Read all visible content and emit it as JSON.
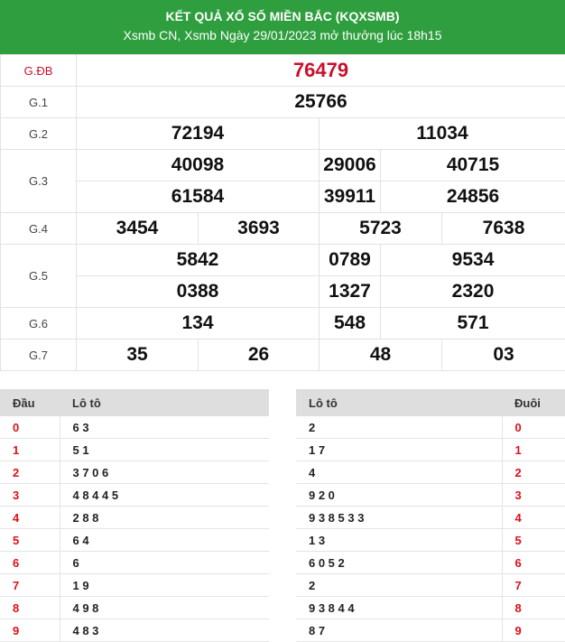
{
  "header": {
    "title": "KẾT QUẢ XỔ SỐ MIỀN BẮC (KQXSMB)",
    "subtitle": "Xsmb CN, Xsmb Ngày 29/01/2023 mở thưởng lúc 18h15"
  },
  "prizes": {
    "db": {
      "label": "G.ĐB",
      "nums": [
        "76479"
      ]
    },
    "g1": {
      "label": "G.1",
      "nums": [
        "25766"
      ]
    },
    "g2": {
      "label": "G.2",
      "nums": [
        "72194",
        "11034"
      ]
    },
    "g3": {
      "label": "G.3",
      "nums": [
        "40098",
        "29006",
        "40715",
        "61584",
        "39911",
        "24856"
      ]
    },
    "g4": {
      "label": "G.4",
      "nums": [
        "3454",
        "3693",
        "5723",
        "7638"
      ]
    },
    "g5": {
      "label": "G.5",
      "nums": [
        "5842",
        "0789",
        "9534",
        "0388",
        "1327",
        "2320"
      ]
    },
    "g6": {
      "label": "G.6",
      "nums": [
        "134",
        "548",
        "571"
      ]
    },
    "g7": {
      "label": "G.7",
      "nums": [
        "35",
        "26",
        "48",
        "03"
      ]
    }
  },
  "dau_table": {
    "col_dau": "Đầu",
    "col_loto": "Lô tô",
    "rows": [
      {
        "key": "0",
        "val": "6 3"
      },
      {
        "key": "1",
        "val": "5 1"
      },
      {
        "key": "2",
        "val": "3 7 0 6"
      },
      {
        "key": "3",
        "val": "4 8 4 4 5"
      },
      {
        "key": "4",
        "val": "2 8 8"
      },
      {
        "key": "5",
        "val": "6 4"
      },
      {
        "key": "6",
        "val": "6"
      },
      {
        "key": "7",
        "val": "1 9"
      },
      {
        "key": "8",
        "val": "4 9 8"
      },
      {
        "key": "9",
        "val": "4 8 3"
      }
    ]
  },
  "duoi_table": {
    "col_loto": "Lô tô",
    "col_duoi": "Đuôi",
    "rows": [
      {
        "val": "2",
        "key": "0"
      },
      {
        "val": "1 7",
        "key": "1"
      },
      {
        "val": "4",
        "key": "2"
      },
      {
        "val": "9 2 0",
        "key": "3"
      },
      {
        "val": "9 3 8 5 3 3",
        "key": "4"
      },
      {
        "val": "1 3",
        "key": "5"
      },
      {
        "val": "6 0 5 2",
        "key": "6"
      },
      {
        "val": "2",
        "key": "7"
      },
      {
        "val": "9 3 8 4 4",
        "key": "8"
      },
      {
        "val": "8 7",
        "key": "9"
      }
    ]
  },
  "colors": {
    "header_bg": "#2e9e3e",
    "special": "#c8102e",
    "key_red": "#e0101a"
  }
}
